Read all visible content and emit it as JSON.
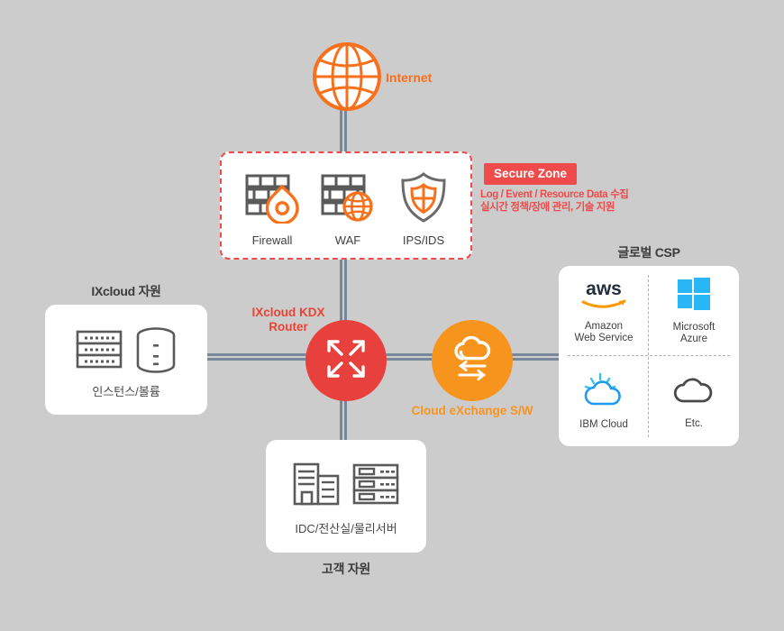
{
  "diagram": {
    "background_color": "#cccccc",
    "accent_red": "#e8403c",
    "accent_orange": "#f7941d",
    "line_color": "#78889b"
  },
  "internet": {
    "label": "Internet",
    "icon": "globe-icon"
  },
  "secure_zone": {
    "badge": "Secure Zone",
    "note_line1": "Log / Event / Resource Data 수집",
    "note_line2": "실시간 정책/장애 관리, 기술 지원",
    "items": [
      {
        "label": "Firewall",
        "icon": "firewall-brick-flame-icon"
      },
      {
        "label": "WAF",
        "icon": "waf-brick-globe-icon"
      },
      {
        "label": "IPS/IDS",
        "icon": "shield-icon"
      }
    ]
  },
  "ixcloud_resources": {
    "title": "IXcloud 자원",
    "caption": "인스턴스/볼륨",
    "icons": [
      "server-rack-icon",
      "database-icon"
    ]
  },
  "customer_resources": {
    "title": "고객 자원",
    "caption": "IDC/전산실/물리서버",
    "icons": [
      "building-icon",
      "server-rack-icon"
    ]
  },
  "router": {
    "label_line1": "IXcloud KDX",
    "label_line2": "Router",
    "icon": "four-way-arrows-icon"
  },
  "cloud_exchange": {
    "label": "Cloud eXchange S/W",
    "icon": "cloud-bidirectional-arrows-icon"
  },
  "csp": {
    "title": "글로벌 CSP",
    "providers": [
      {
        "name_line1": "Amazon",
        "name_line2": "Web Service",
        "icon": "aws-logo-icon",
        "color": "#ff9900"
      },
      {
        "name_line1": "Microsoft",
        "name_line2": "Azure",
        "icon": "microsoft-azure-logo-icon",
        "color": "#29b6f6"
      },
      {
        "name_line1": "IBM Cloud",
        "name_line2": "",
        "icon": "ibm-cloud-icon",
        "color": "#1e9bf0"
      },
      {
        "name_line1": "Etc.",
        "name_line2": "",
        "icon": "cloud-icon",
        "color": "#4a4a4a"
      }
    ]
  }
}
